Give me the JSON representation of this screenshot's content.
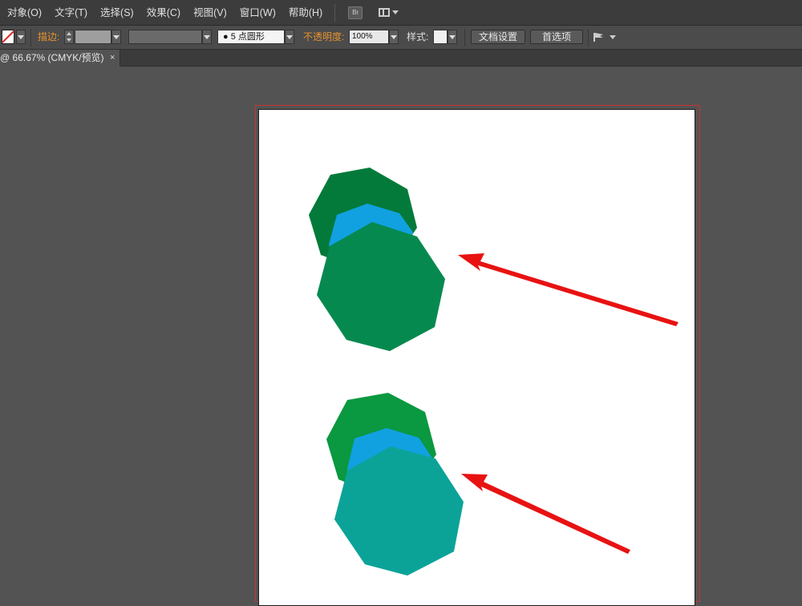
{
  "menu": {
    "items": [
      "对象(O)",
      "文字(T)",
      "选择(S)",
      "效果(C)",
      "视图(V)",
      "窗口(W)",
      "帮助(H)"
    ],
    "bridge_label": "Br"
  },
  "control": {
    "stroke_label": "描边:",
    "brush_value": "●  5 点圆形",
    "opacity_label": "不透明度:",
    "opacity_value": "100%",
    "style_label": "样式:",
    "document_setup_label": "文档设置",
    "preferences_label": "首选项"
  },
  "tab": {
    "title": "@ 66.67% (CMYK/预览)",
    "close": "×"
  },
  "colors": {
    "dark_green": "#037a3a",
    "blue": "#11a1e0",
    "mid_green": "#06894f",
    "bright_green": "#0a9840",
    "teal": "#0ba398",
    "arrow_red": "#e81212"
  },
  "icons": [
    "fill-stroke-swatch-icon",
    "workspace-layout-icon",
    "arrange-documents-icon",
    "bridge-icon"
  ]
}
